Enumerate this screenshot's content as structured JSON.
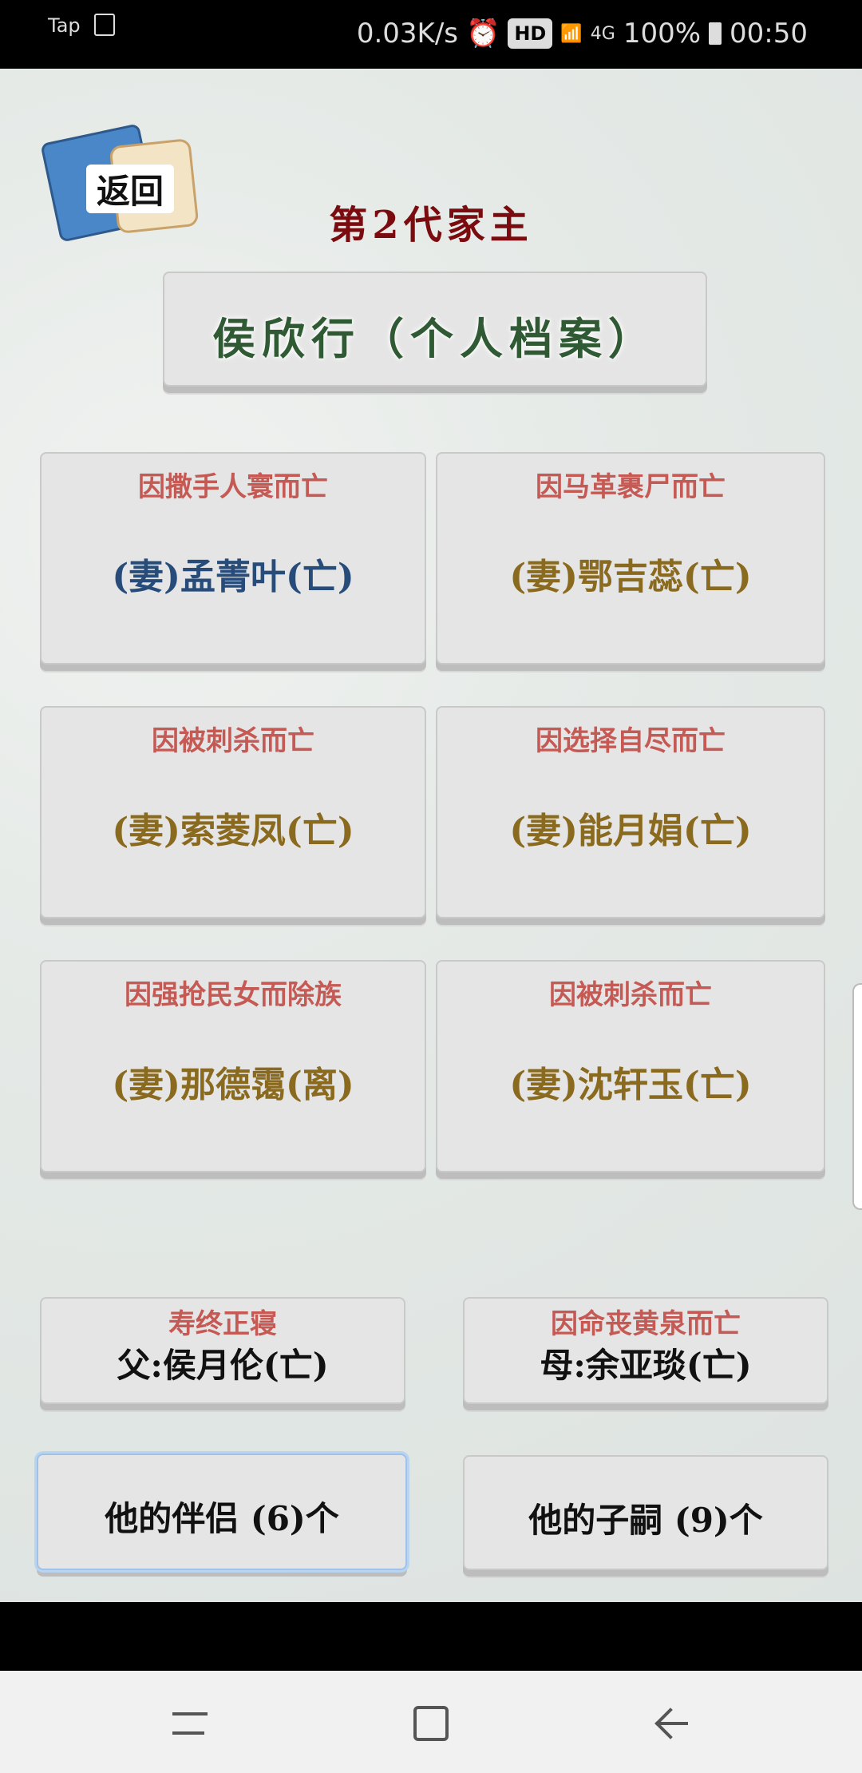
{
  "status_bar": {
    "left_app": "Tap",
    "speed": "0.03K/s",
    "hd": "HD",
    "signal": "4G",
    "battery": "100%",
    "time": "00:50"
  },
  "header": {
    "back_label": "返回",
    "generation_title": "第2代家主",
    "person_title": "侯欣行（个人档案）"
  },
  "spouses": [
    {
      "cause": "因撒手人寰而亡",
      "name": "(妻)孟菁叶(亡)",
      "color": "#274c7a"
    },
    {
      "cause": "因马革裹尸而亡",
      "name": "(妻)鄂吉蕊(亡)",
      "color": "#8a6a1e"
    },
    {
      "cause": "因被刺杀而亡",
      "name": "(妻)索菱凤(亡)",
      "color": "#8a6a1e"
    },
    {
      "cause": "因选择自尽而亡",
      "name": "(妻)能月娟(亡)",
      "color": "#8a6a1e"
    },
    {
      "cause": "因强抢民女而除族",
      "name": "(妻)那德霭(离)",
      "color": "#8a6a1e"
    },
    {
      "cause": "因被刺杀而亡",
      "name": "(妻)沈轩玉(亡)",
      "color": "#8a6a1e"
    }
  ],
  "parents": {
    "father": {
      "cause": "寿终正寝",
      "name": "父:侯月伦(亡)"
    },
    "mother": {
      "cause": "因命丧黄泉而亡",
      "name": "母:余亚琰(亡)"
    }
  },
  "buttons": {
    "partners": "他的伴侣 (6)个",
    "children": "他的子嗣 (9)个"
  }
}
